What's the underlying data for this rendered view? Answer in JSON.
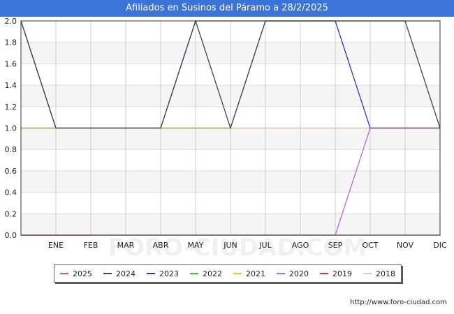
{
  "title": "Afiliados en Susinos del Páramo a 28/2/2025",
  "source_url": "http://www.foro-ciudad.com",
  "watermark": "FORO-CIUDAD.COM",
  "chart_data": {
    "type": "line",
    "title": "Afiliados en Susinos del Páramo a 28/2/2025",
    "xlabel": "",
    "ylabel": "",
    "categories": [
      "",
      "ENE",
      "FEB",
      "MAR",
      "ABR",
      "MAY",
      "JUN",
      "JUL",
      "AGO",
      "SEP",
      "OCT",
      "NOV",
      "DIC"
    ],
    "ylim": [
      0,
      2.0
    ],
    "yticks": [
      "0.0",
      "0.2",
      "0.4",
      "0.6",
      "0.8",
      "1.0",
      "1.2",
      "1.4",
      "1.6",
      "1.8",
      "2.0"
    ],
    "grid": true,
    "legend_position": "bottom",
    "series": [
      {
        "name": "2025",
        "color": "#ff4d4d",
        "values": [
          0,
          0,
          0
        ]
      },
      {
        "name": "2024",
        "color": "#444444",
        "values": [
          2,
          1,
          1,
          1,
          1,
          2,
          1,
          2,
          2,
          2,
          2,
          2,
          1
        ]
      },
      {
        "name": "2023",
        "color": "#3333cc",
        "values": [
          2,
          1,
          1,
          1,
          1,
          2,
          2,
          2,
          2,
          2,
          1,
          1,
          1
        ]
      },
      {
        "name": "2022",
        "color": "#33cc33",
        "values": [
          1,
          1,
          1,
          1,
          1,
          1,
          1,
          2,
          2,
          2,
          2,
          2,
          2
        ]
      },
      {
        "name": "2021",
        "color": "#ffb833",
        "values": [
          1,
          1,
          1,
          1,
          1,
          1,
          1,
          1,
          1,
          1,
          1,
          1,
          1
        ]
      },
      {
        "name": "2020",
        "color": "#b366e6",
        "values": [
          0,
          0,
          0,
          0,
          0,
          0,
          0,
          0,
          0,
          0,
          1,
          1,
          1
        ]
      },
      {
        "name": "2019",
        "color": "#993d80",
        "values": [
          0,
          0,
          0,
          0,
          0,
          0,
          0,
          0,
          0,
          0,
          0,
          0,
          0
        ]
      },
      {
        "name": "2018",
        "color": "#cccccc",
        "values": []
      }
    ]
  }
}
